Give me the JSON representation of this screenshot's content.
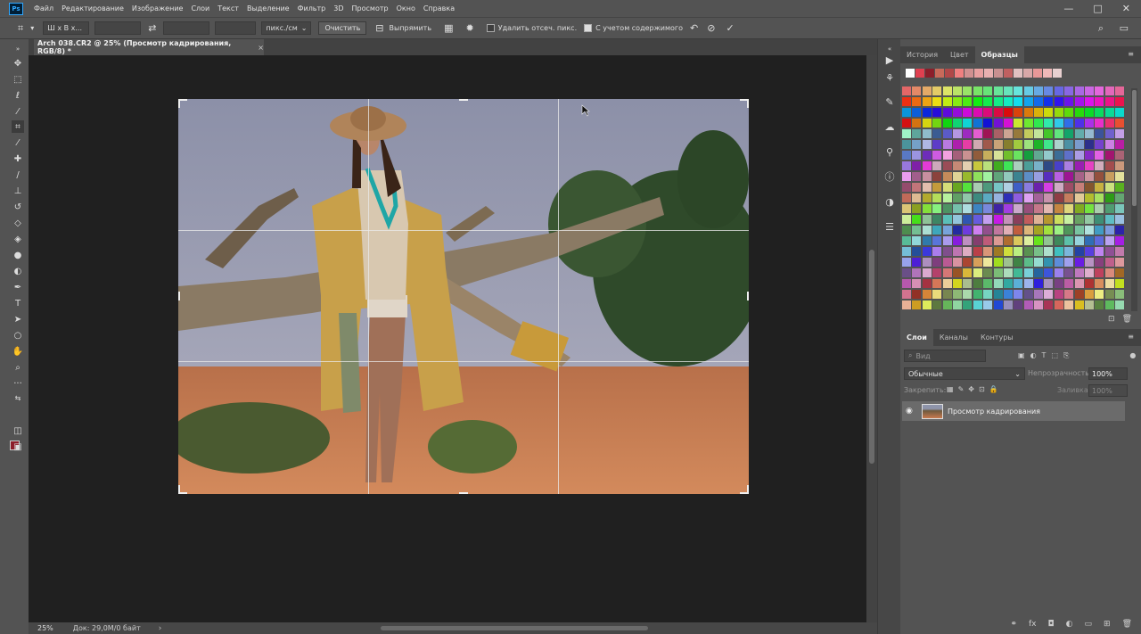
{
  "menu": [
    "Файл",
    "Редактирование",
    "Изображение",
    "Слои",
    "Текст",
    "Выделение",
    "Фильтр",
    "3D",
    "Просмотр",
    "Окно",
    "Справка"
  ],
  "app_logo": "Ps",
  "window_controls": {
    "minimize": "—",
    "maximize": "□",
    "close": "✕"
  },
  "options_bar": {
    "ratio_select": "Ш х В х...",
    "units_select": "пикс./см",
    "clear_button": "Очистить",
    "straighten_label": "Выпрямить",
    "delete_cropped_label": "Удалить отсеч. пикс.",
    "content_aware_label": "С учетом содержимого",
    "content_aware_checked": true,
    "delete_cropped_checked": false
  },
  "document": {
    "tab_title": "Arch 038.CR2 @ 25% (Просмотр кадрирования, RGB/8) *",
    "tab_close": "×"
  },
  "status_bar": {
    "zoom": "25%",
    "doc_info": "Док: 29,0M/0 байт",
    "arrow": "›"
  },
  "swatches_panel": {
    "tabs": [
      "История",
      "Цвет",
      "Образцы"
    ],
    "active_tab": "Образцы",
    "recent": [
      "#ffffff",
      "#e04050",
      "#8c1e2a",
      "#c86a5a",
      "#b04848",
      "#f08080",
      "#d09090",
      "#e8a0a0",
      "#e8b0b0",
      "#c89090",
      "#c06060",
      "#e0c0c0",
      "#d8a8a8",
      "#e89898",
      "#f0b8b8",
      "#e8d0d0"
    ]
  },
  "layers_panel": {
    "tabs": [
      "Слои",
      "Каналы",
      "Контуры"
    ],
    "active_tab": "Слои",
    "search_placeholder": "Вид",
    "blend_mode": "Обычные",
    "opacity_label": "Непрозрачность:",
    "opacity_value": "100%",
    "lock_label": "Закрепить:",
    "fill_label": "Заливка:",
    "fill_value": "100%",
    "layers": [
      {
        "name": "Просмотр кадрирования",
        "visible": true
      }
    ]
  },
  "colors": {
    "ui_bg": "#535353",
    "canvas_bg": "#202020",
    "foreground": "#8c1e2a",
    "background": "#ffffff"
  }
}
